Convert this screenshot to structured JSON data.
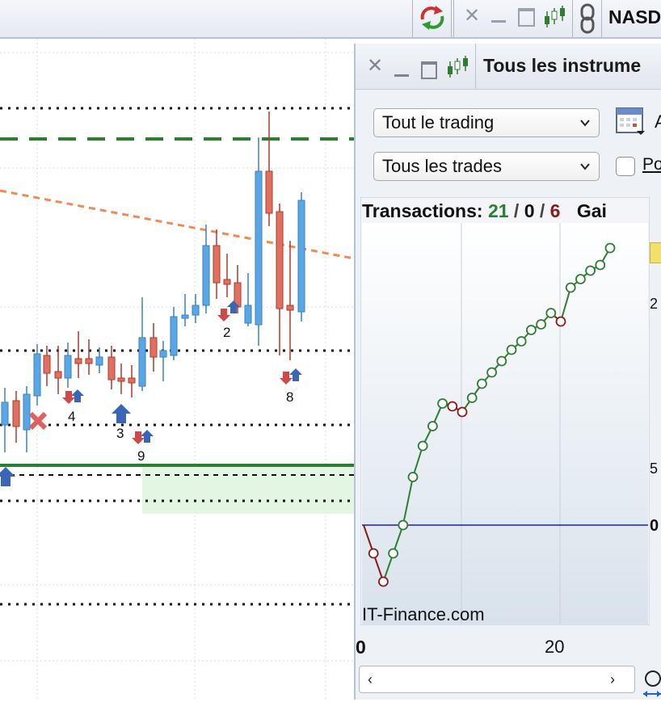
{
  "toolbar": {
    "symbol_text": "NASD",
    "icons": [
      "refresh-icon",
      "close-icon",
      "minimize-icon",
      "maximize-icon",
      "candlestick-icon",
      "link-icon"
    ]
  },
  "chart": {
    "trade_labels": [
      "2",
      "4",
      "3",
      "9",
      "8"
    ]
  },
  "panel": {
    "title": "Tous les instrume",
    "select_period": "Tout le trading",
    "select_trades": "Tous les trades",
    "calendar_label": "A",
    "checkbox_label": "Po",
    "transactions": {
      "label": "Transactions:",
      "wins": "21",
      "sep1": "/",
      "even": "0",
      "sep2": "/",
      "losses": "6",
      "gain_label": "Gai"
    },
    "watermark": "IT-Finance.com",
    "x_ticks": [
      "0",
      "20"
    ],
    "y_tick_partial": [
      "2",
      "5",
      "0"
    ]
  },
  "colors": {
    "win": "#2e7d32",
    "loss": "#8b1a1a",
    "bull": "#5aa7e6",
    "bear": "#e07060",
    "zero_line": "#0000cc"
  },
  "chart_data": {
    "type": "line",
    "title": "",
    "x_ticks": [
      0,
      20
    ],
    "series": [
      {
        "values": [
          0,
          -1,
          -2,
          -1,
          0,
          1.7,
          2.8,
          3.5,
          4.3,
          4.2,
          4.0,
          4.5,
          5.0,
          5.4,
          5.8,
          6.2,
          6.5,
          6.9,
          7.1,
          7.5,
          7.2,
          8.4,
          8.7,
          9.0,
          9.2,
          9.8
        ]
      }
    ]
  }
}
